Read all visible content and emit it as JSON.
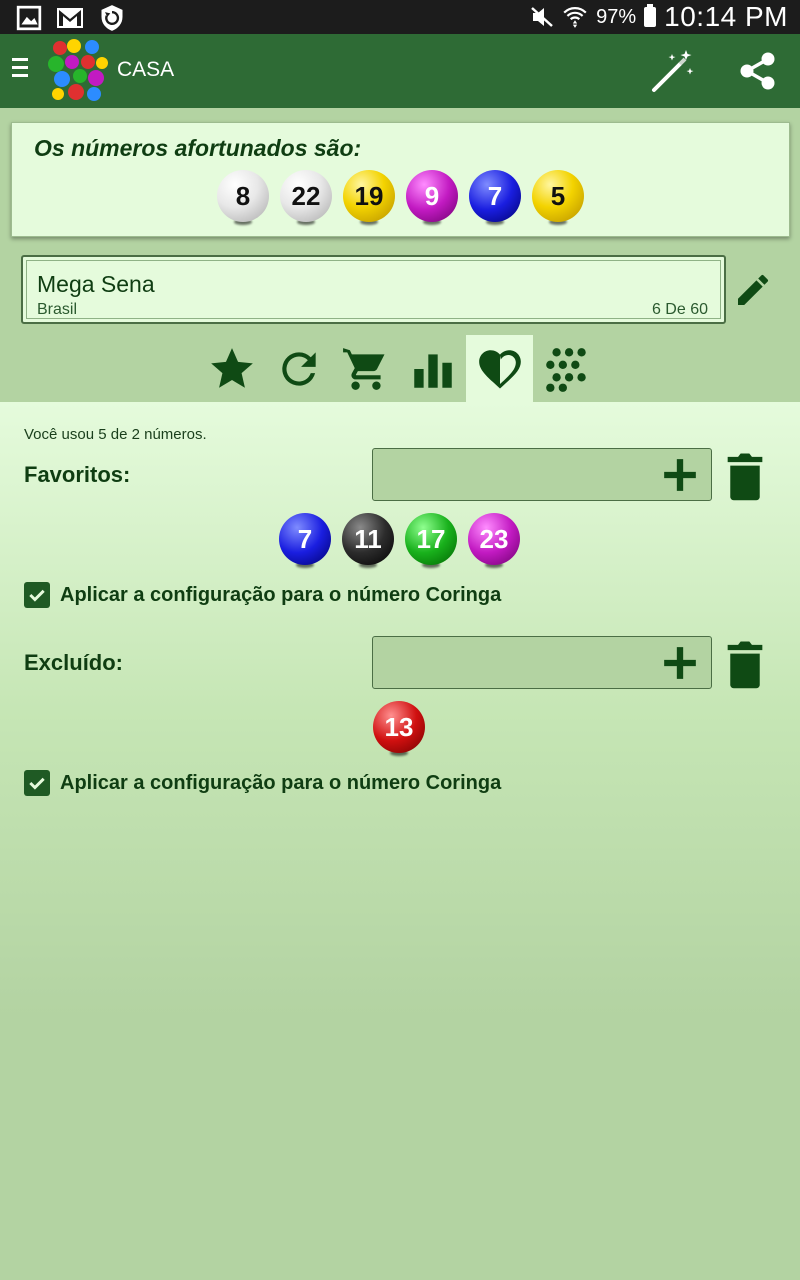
{
  "status_bar": {
    "battery": "97%",
    "time": "10:14 PM"
  },
  "app_bar": {
    "title": "CASA"
  },
  "lucky": {
    "title": "Os números afortunados são:",
    "balls": [
      {
        "number": "8",
        "color": "white"
      },
      {
        "number": "22",
        "color": "white"
      },
      {
        "number": "19",
        "color": "yellow"
      },
      {
        "number": "9",
        "color": "purple"
      },
      {
        "number": "7",
        "color": "blue"
      },
      {
        "number": "5",
        "color": "yellow"
      }
    ]
  },
  "game": {
    "name": "Mega Sena",
    "country": "Brasil",
    "format": "6 De 60"
  },
  "tabs": [
    {
      "icon": "star-icon",
      "active": false
    },
    {
      "icon": "refresh-icon",
      "active": false
    },
    {
      "icon": "cart-icon",
      "active": false
    },
    {
      "icon": "bar-chart-icon",
      "active": false
    },
    {
      "icon": "heart-icon",
      "active": true
    },
    {
      "icon": "dots-icon",
      "active": false
    }
  ],
  "content": {
    "usage": "Você usou 5 de 2 números.",
    "favorites": {
      "label": "Favoritos:",
      "balls": [
        {
          "number": "7",
          "color": "blue"
        },
        {
          "number": "11",
          "color": "black"
        },
        {
          "number": "17",
          "color": "green"
        },
        {
          "number": "23",
          "color": "purple"
        }
      ],
      "checkbox_label": "Aplicar a configuração para o número Coringa",
      "checked": true
    },
    "excluded": {
      "label": "Excluído:",
      "balls": [
        {
          "number": "13",
          "color": "red"
        }
      ],
      "checkbox_label": "Aplicar a configuração para o número Coringa",
      "checked": true
    }
  },
  "colors": {
    "app_bar": "#2e6b35",
    "background": "#b3d3a2",
    "card": "#e5fbdc",
    "text_dark_green": "#0f3d12"
  }
}
